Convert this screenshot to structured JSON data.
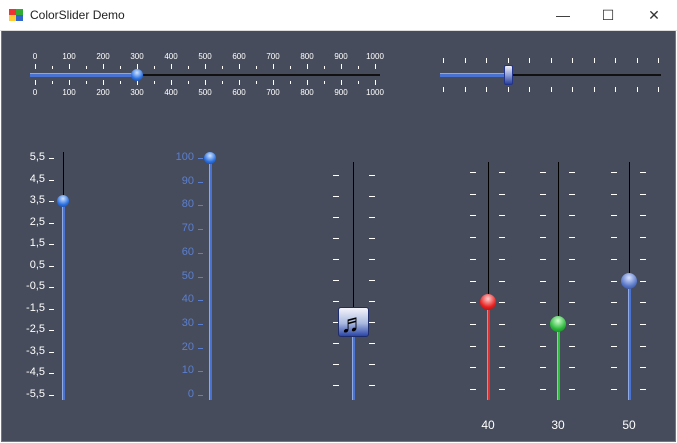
{
  "window": {
    "title": "ColorSlider Demo",
    "minimize": "—",
    "maximize": "☐",
    "close": "✕"
  },
  "colors": {
    "background": "#464c5b",
    "track_fill": "#4a72d0",
    "red": "#e03030",
    "green": "#30c040",
    "blue": "#4a72d0"
  },
  "sliders": {
    "top_left": {
      "min": 0,
      "max": 1000,
      "value": 300,
      "labels": [
        "0",
        "100",
        "200",
        "300",
        "400",
        "500",
        "600",
        "700",
        "800",
        "900",
        "1000"
      ]
    },
    "top_right": {
      "min": 0,
      "max": 10,
      "value": 3
    },
    "vertical_decimal": {
      "value": 3.5,
      "labels": [
        "5,5",
        "4,5",
        "3,5",
        "2,5",
        "1,5",
        "0,5",
        "-0,5",
        "-1,5",
        "-2,5",
        "-3,5",
        "-4,5",
        "-5,5"
      ]
    },
    "vertical_percent": {
      "value": 100,
      "labels": [
        "100",
        "90",
        "80",
        "70",
        "60",
        "50",
        "40",
        "30",
        "20",
        "10",
        "0"
      ]
    },
    "music": {
      "value": 30,
      "icon": "music-note-icon"
    },
    "red": {
      "value": 40,
      "label": "40"
    },
    "green": {
      "value": 30,
      "label": "30"
    },
    "blue": {
      "value": 50,
      "label": "50"
    }
  }
}
